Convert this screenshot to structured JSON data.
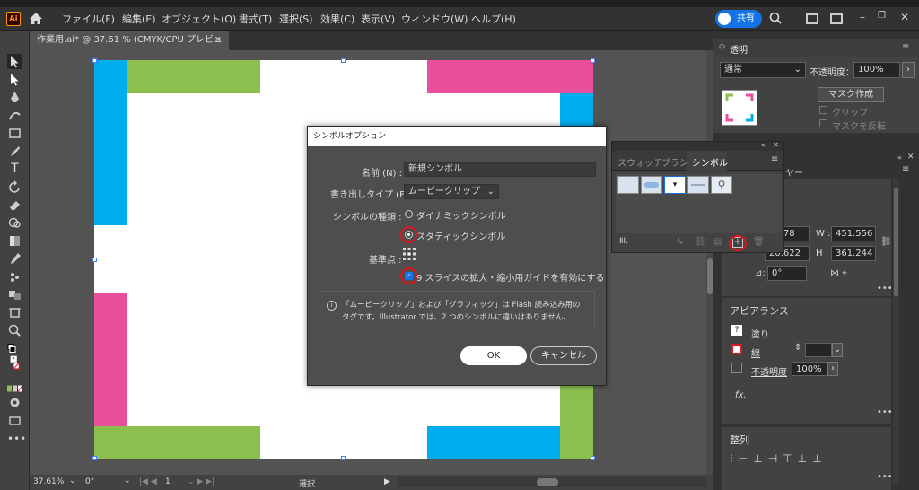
{
  "menubar": {
    "logo": "Ai",
    "items": [
      "ファイル(F)",
      "編集(E)",
      "オブジェクト(O)",
      "書式(T)",
      "選択(S)",
      "効果(C)",
      "表示(V)",
      "ウィンドウ(W)",
      "ヘルプ(H)"
    ],
    "share_label": "共有"
  },
  "document": {
    "tab_title": "作業用.ai* @ 37.61 % (CMYK/CPU プレビュー)",
    "close": "×"
  },
  "statusbar": {
    "zoom": "37.61%",
    "rotation": "0°",
    "page": "1",
    "mode": "選択"
  },
  "transparency_panel": {
    "title": "透明",
    "blend_mode": "通常",
    "opacity_label": "不透明度：",
    "opacity_value": "100%",
    "mask_button": "マスク作成",
    "clip_label": "クリップ",
    "invert_label": "マスクを反転"
  },
  "symbols_panel": {
    "tabs": [
      "スウォッチ",
      "ブラシ",
      "シンボル"
    ],
    "active_tab": "シンボル"
  },
  "transform_panel": {
    "tab_partial": "ヤー",
    "x_value": "5.778",
    "y_value": "20.622",
    "w_label": "W :",
    "w_value": "451.556",
    "h_label": "H :",
    "h_value": "361.244",
    "angle_value": "0°"
  },
  "appearance_panel": {
    "title": "アピアランス",
    "fill_label": "塗り",
    "stroke_label": "線",
    "opacity_label": "不透明度",
    "opacity_value": "100%",
    "fx_label": "fx."
  },
  "align_panel": {
    "title": "整列"
  },
  "dialog": {
    "title": "シンボルオプション",
    "name_label": "名前 (N) :",
    "name_value": "新規シンボル",
    "export_type_label": "書き出しタイプ (E) :",
    "export_type_value": "ムービークリップ",
    "symbol_type_label": "シンボルの種類 :",
    "dynamic_label": "ダイナミックシンボル",
    "static_label": "スタティックシンボル",
    "registration_label": "基準点 :",
    "nine_slice_label": "9 スライスの拡大・縮小用ガイドを有効にする",
    "info_line1": "「ムービークリップ」および「グラフィック」は Flash 読み込み用の",
    "info_line2": "タグです。Illustrator では、2 つのシンボルに違いはありません。",
    "ok_label": "OK",
    "cancel_label": "キャンセル"
  },
  "colors": {
    "cyan": "#00adef",
    "green": "#8dbf4f",
    "pink": "#e94e9c",
    "share_blue": "#1473e6",
    "highlight_red": "#e0141e"
  }
}
